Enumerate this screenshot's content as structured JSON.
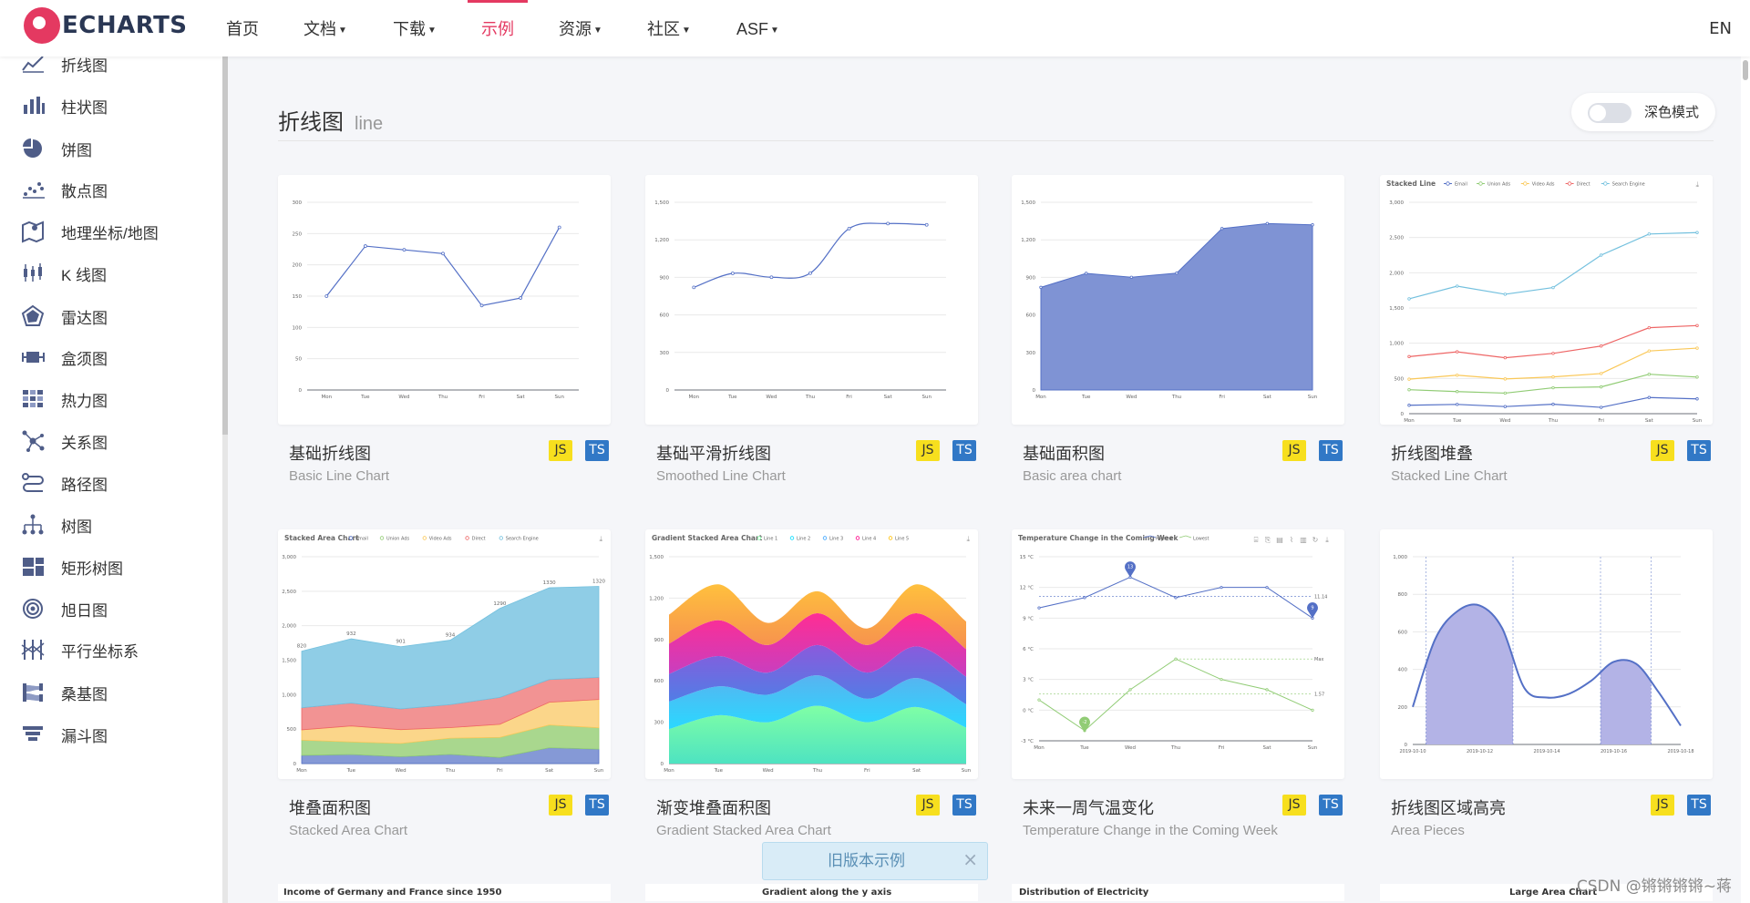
{
  "brand": {
    "name": "ECHARTS",
    "accent": "#e43961"
  },
  "nav": {
    "items": [
      {
        "label": "首页"
      },
      {
        "label": "文档",
        "dropdown": true
      },
      {
        "label": "下载",
        "dropdown": true
      },
      {
        "label": "示例",
        "active": true
      },
      {
        "label": "资源",
        "dropdown": true
      },
      {
        "label": "社区",
        "dropdown": true
      },
      {
        "label": "ASF",
        "dropdown": true
      }
    ],
    "lang": "EN"
  },
  "sidebar": {
    "items": [
      {
        "label": "折线图",
        "icon": "line-chart-icon"
      },
      {
        "label": "柱状图",
        "icon": "bar-chart-icon"
      },
      {
        "label": "饼图",
        "icon": "pie-chart-icon"
      },
      {
        "label": "散点图",
        "icon": "scatter-icon"
      },
      {
        "label": "地理坐标/地图",
        "icon": "map-icon"
      },
      {
        "label": "K 线图",
        "icon": "candlestick-icon"
      },
      {
        "label": "雷达图",
        "icon": "radar-icon"
      },
      {
        "label": "盒须图",
        "icon": "boxplot-icon"
      },
      {
        "label": "热力图",
        "icon": "heatmap-icon"
      },
      {
        "label": "关系图",
        "icon": "graph-icon"
      },
      {
        "label": "路径图",
        "icon": "lines-icon"
      },
      {
        "label": "树图",
        "icon": "tree-icon"
      },
      {
        "label": "矩形树图",
        "icon": "treemap-icon"
      },
      {
        "label": "旭日图",
        "icon": "sunburst-icon"
      },
      {
        "label": "平行坐标系",
        "icon": "parallel-icon"
      },
      {
        "label": "桑基图",
        "icon": "sankey-icon"
      },
      {
        "label": "漏斗图",
        "icon": "funnel-icon"
      }
    ]
  },
  "section": {
    "title": "折线图",
    "subtitle": "line",
    "dark_mode_label": "深色模式"
  },
  "badges": {
    "js": "JS",
    "ts": "TS"
  },
  "cards": [
    {
      "title": "基础折线图",
      "subtitle": "Basic Line Chart"
    },
    {
      "title": "基础平滑折线图",
      "subtitle": "Smoothed Line Chart"
    },
    {
      "title": "基础面积图",
      "subtitle": "Basic area chart"
    },
    {
      "title": "折线图堆叠",
      "subtitle": "Stacked Line Chart"
    },
    {
      "title": "堆叠面积图",
      "subtitle": "Stacked Area Chart"
    },
    {
      "title": "渐变堆叠面积图",
      "subtitle": "Gradient Stacked Area Chart"
    },
    {
      "title": "未来一周气温变化",
      "subtitle": "Temperature Change in the Coming Week"
    },
    {
      "title": "折线图区域高亮",
      "subtitle": "Area Pieces"
    }
  ],
  "peek_titles": [
    "Income of Germany and France since 1950",
    "Gradient along the y axis",
    "Distribution of Electricity",
    "Large Area Chart"
  ],
  "old_version": {
    "label": "旧版本示例",
    "close": "×"
  },
  "watermark": "CSDN @锵锵锵锵~蒋",
  "thumbs": {
    "days": [
      "Mon",
      "Tue",
      "Wed",
      "Thu",
      "Fri",
      "Sat",
      "Sun"
    ],
    "basic": {
      "values": [
        150,
        230,
        224,
        218,
        135,
        147,
        260
      ],
      "ticks": [
        "0",
        "50",
        "100",
        "150",
        "200",
        "250",
        "300"
      ]
    },
    "smooth": {
      "values": [
        820,
        932,
        901,
        934,
        1290,
        1330,
        1320
      ],
      "ticks": [
        "0",
        "300",
        "600",
        "900",
        "1,200",
        "1,500"
      ]
    },
    "area": {
      "values": [
        820,
        932,
        901,
        934,
        1290,
        1330,
        1320
      ],
      "ticks": [
        "0",
        "300",
        "600",
        "900",
        "1,200",
        "1,500"
      ]
    },
    "stacked_line": {
      "title": "Stacked Line",
      "legend": [
        "Email",
        "Union Ads",
        "Video Ads",
        "Direct",
        "Search Engine"
      ],
      "colors": [
        "#5470c6",
        "#91cc75",
        "#fac858",
        "#ee6666",
        "#73c0de"
      ],
      "series": [
        [
          120,
          132,
          101,
          134,
          90,
          230,
          210
        ],
        [
          220,
          182,
          191,
          234,
          290,
          330,
          310
        ],
        [
          150,
          232,
          201,
          154,
          190,
          330,
          410
        ],
        [
          320,
          332,
          301,
          334,
          390,
          330,
          320
        ],
        [
          820,
          932,
          901,
          934,
          1290,
          1330,
          1320
        ]
      ],
      "ticks": [
        "0",
        "500",
        "1,000",
        "1,500",
        "2,000",
        "2,500",
        "3,000"
      ]
    },
    "stacked_area": {
      "title": "Stacked Area Chart",
      "legend": [
        "Email",
        "Union Ads",
        "Video Ads",
        "Direct",
        "Search Engine"
      ],
      "labels": [
        "820",
        "932",
        "901",
        "934",
        "1290",
        "1330",
        "1320"
      ],
      "ticks": [
        "0",
        "500",
        "1,000",
        "1,500",
        "2,000",
        "2,500",
        "3,000"
      ]
    },
    "gradient_area": {
      "title": "Gradient Stacked Area Chart",
      "legend": [
        "Line 1",
        "Line 2",
        "Line 3",
        "Line 4",
        "Line 5"
      ],
      "ticks": [
        "0",
        "300",
        "600",
        "900",
        "1,200",
        "1,500"
      ]
    },
    "temperature": {
      "title": "Temperature Change in the Coming Week",
      "legend": [
        "Highest",
        "Lowest"
      ],
      "high": [
        10,
        11,
        13,
        11,
        12,
        12,
        9
      ],
      "low": [
        1,
        -2,
        2,
        5,
        3,
        2,
        0
      ],
      "ticks": [
        "-3 °C",
        "0 °C",
        "3 °C",
        "6 °C",
        "9 °C",
        "12 °C",
        "15 °C"
      ],
      "marks": [
        "13",
        "-2",
        "11.14",
        "9",
        "Max",
        "1.57"
      ]
    },
    "pieces": {
      "dates": [
        "2019-10-10",
        "2019-10-12",
        "2019-10-14",
        "2019-10-16",
        "2019-10-18"
      ],
      "ticks": [
        "0",
        "200",
        "400",
        "600",
        "800",
        "1,000"
      ]
    }
  }
}
